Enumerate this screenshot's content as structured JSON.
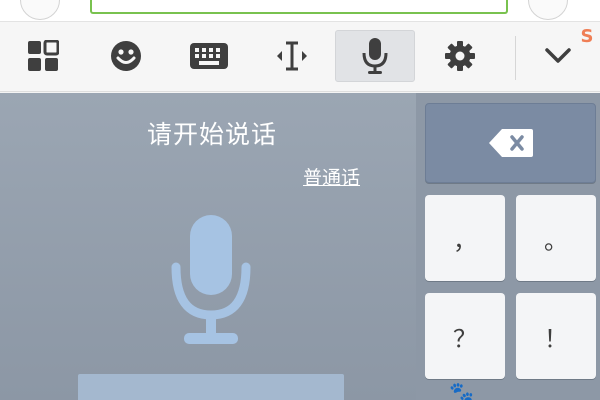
{
  "toolbar": {
    "items": [
      {
        "name": "grid"
      },
      {
        "name": "emoji"
      },
      {
        "name": "keyboard"
      },
      {
        "name": "cursor"
      },
      {
        "name": "microphone",
        "active": true
      },
      {
        "name": "settings"
      },
      {
        "name": "collapse"
      }
    ],
    "logo": "S"
  },
  "voice": {
    "prompt": "请开始说话",
    "language": "普通话"
  },
  "keys": {
    "comma": "，",
    "period": "。",
    "question": "？",
    "exclaim": "！"
  },
  "colors": {
    "panel": "#9aa5b2",
    "mic": "#a6c3e3",
    "accent_green": "#79c24f"
  }
}
